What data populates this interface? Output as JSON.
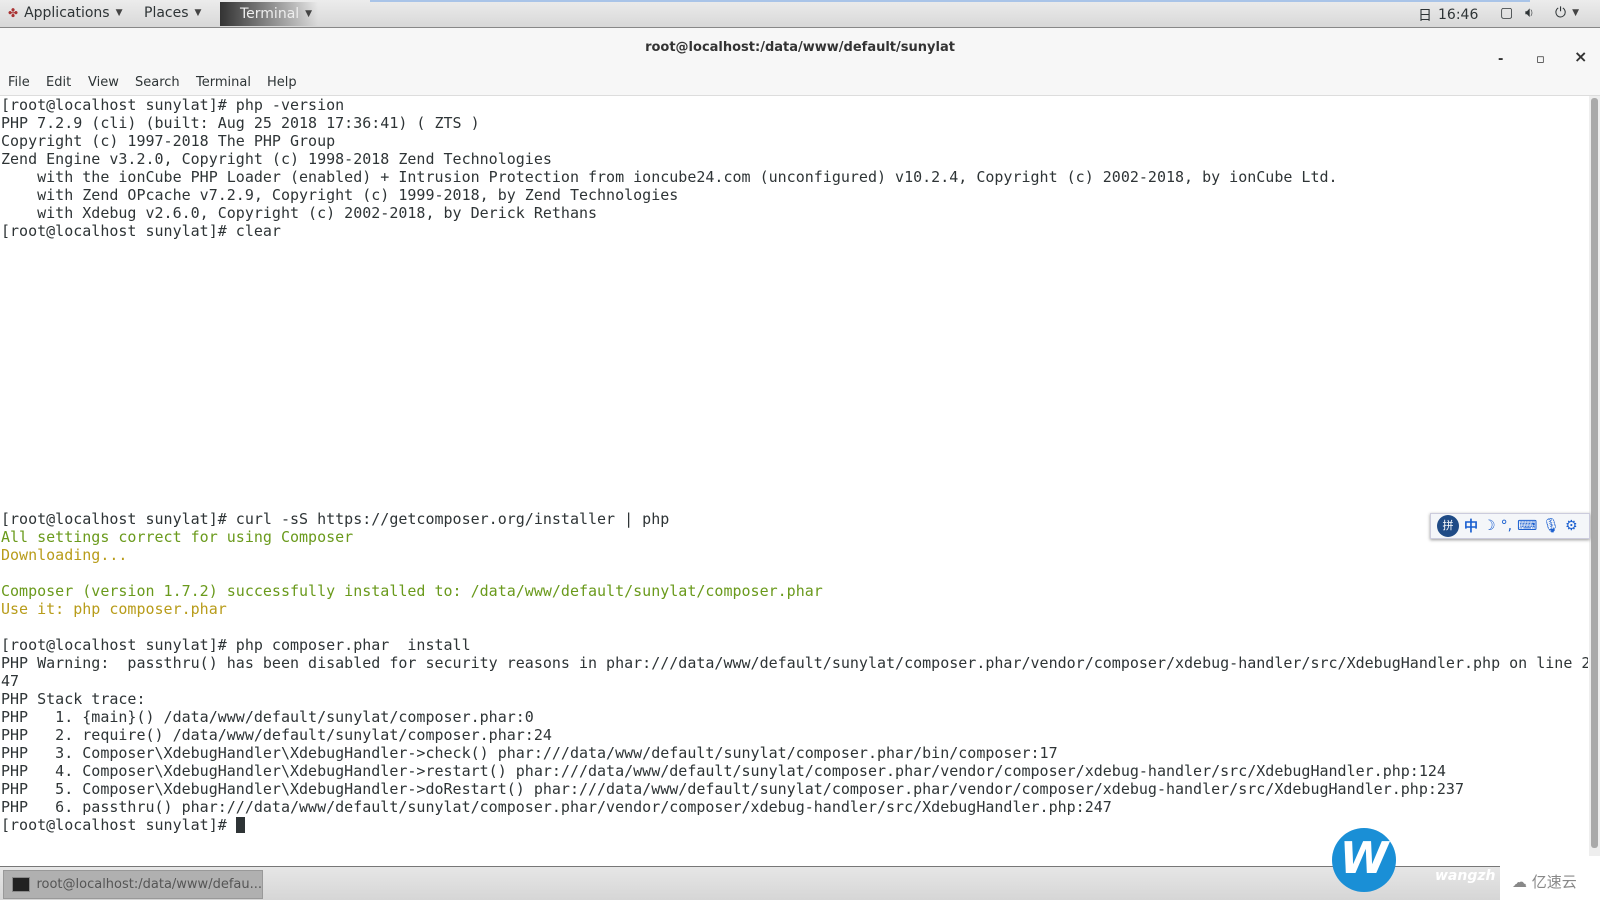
{
  "topbar": {
    "applications": "Applications",
    "places": "Places",
    "terminal": "Terminal",
    "clock": "16:46",
    "calendar_icon": "日"
  },
  "window": {
    "title": "root@localhost:/data/www/default/sunylat",
    "minimize": "-",
    "maximize": "▫",
    "close": "×"
  },
  "menu": [
    "File",
    "Edit",
    "View",
    "Search",
    "Terminal",
    "Help"
  ],
  "terminal": {
    "lines": [
      {
        "text": "[root@localhost sunylat]# php -version",
        "c": ""
      },
      {
        "text": "PHP 7.2.9 (cli) (built: Aug 25 2018 17:36:41) ( ZTS )",
        "c": ""
      },
      {
        "text": "Copyright (c) 1997-2018 The PHP Group",
        "c": ""
      },
      {
        "text": "Zend Engine v3.2.0, Copyright (c) 1998-2018 Zend Technologies",
        "c": ""
      },
      {
        "text": "    with the ionCube PHP Loader (enabled) + Intrusion Protection from ioncube24.com (unconfigured) v10.2.4, Copyright (c) 2002-2018, by ionCube Ltd.",
        "c": ""
      },
      {
        "text": "    with Zend OPcache v7.2.9, Copyright (c) 1999-2018, by Zend Technologies",
        "c": ""
      },
      {
        "text": "    with Xdebug v2.6.0, Copyright (c) 2002-2018, by Derick Rethans",
        "c": ""
      },
      {
        "text": "[root@localhost sunylat]# clear",
        "c": ""
      },
      {
        "text": "",
        "c": ""
      },
      {
        "text": "",
        "c": ""
      },
      {
        "text": "",
        "c": ""
      },
      {
        "text": "",
        "c": ""
      },
      {
        "text": "",
        "c": ""
      },
      {
        "text": "",
        "c": ""
      },
      {
        "text": "",
        "c": ""
      },
      {
        "text": "",
        "c": ""
      },
      {
        "text": "",
        "c": ""
      },
      {
        "text": "",
        "c": ""
      },
      {
        "text": "",
        "c": ""
      },
      {
        "text": "",
        "c": ""
      },
      {
        "text": "",
        "c": ""
      },
      {
        "text": "",
        "c": ""
      },
      {
        "text": "",
        "c": ""
      },
      {
        "text": "[root@localhost sunylat]# curl -sS https://getcomposer.org/installer | php",
        "c": ""
      },
      {
        "text": "All settings correct for using Composer",
        "c": "g"
      },
      {
        "text": "Downloading...",
        "c": "y"
      },
      {
        "text": "",
        "c": ""
      },
      {
        "text": "Composer (version 1.7.2) successfully installed to: /data/www/default/sunylat/composer.phar",
        "c": "g"
      },
      {
        "text": "Use it: php composer.phar",
        "c": "y"
      },
      {
        "text": "",
        "c": ""
      },
      {
        "text": "[root@localhost sunylat]# php composer.phar  install",
        "c": ""
      },
      {
        "text": "PHP Warning:  passthru() has been disabled for security reasons in phar:///data/www/default/sunylat/composer.phar/vendor/composer/xdebug-handler/src/XdebugHandler.php on line 2",
        "c": ""
      },
      {
        "text": "47",
        "c": ""
      },
      {
        "text": "PHP Stack trace:",
        "c": ""
      },
      {
        "text": "PHP   1. {main}() /data/www/default/sunylat/composer.phar:0",
        "c": ""
      },
      {
        "text": "PHP   2. require() /data/www/default/sunylat/composer.phar:24",
        "c": ""
      },
      {
        "text": "PHP   3. Composer\\XdebugHandler\\XdebugHandler->check() phar:///data/www/default/sunylat/composer.phar/bin/composer:17",
        "c": ""
      },
      {
        "text": "PHP   4. Composer\\XdebugHandler\\XdebugHandler->restart() phar:///data/www/default/sunylat/composer.phar/vendor/composer/xdebug-handler/src/XdebugHandler.php:124",
        "c": ""
      },
      {
        "text": "PHP   5. Composer\\XdebugHandler\\XdebugHandler->doRestart() phar:///data/www/default/sunylat/composer.phar/vendor/composer/xdebug-handler/src/XdebugHandler.php:237",
        "c": ""
      },
      {
        "text": "PHP   6. passthru() phar:///data/www/default/sunylat/composer.phar/vendor/composer/xdebug-handler/src/XdebugHandler.php:247",
        "c": ""
      }
    ],
    "prompt": "[root@localhost sunylat]# ",
    "colors": {
      "green": "#6a9a1c",
      "yellow": "#b89c1a"
    }
  },
  "ime": {
    "logo": "拼",
    "mode": "中",
    "items": [
      "moon-icon",
      "punctuation-icon",
      "keyboard-icon",
      "mic-icon",
      "gear-icon"
    ]
  },
  "taskbar": {
    "task": "root@localhost:/data/www/defau..."
  },
  "watermark": {
    "letter": "W",
    "text": "wangzh",
    "brand": "亿速云"
  }
}
